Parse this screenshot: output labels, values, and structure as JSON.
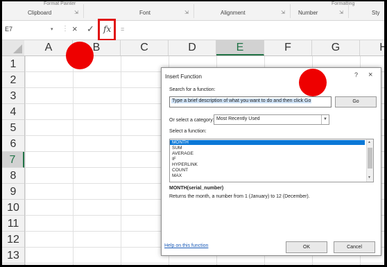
{
  "ribbon": {
    "groups": [
      "Clipboard",
      "Font",
      "Alignment",
      "Number",
      "Sty"
    ],
    "top_cut": [
      "Format Painter",
      "Formatting"
    ]
  },
  "formula_bar": {
    "name_box": "E7",
    "cancel_icon": "×",
    "enter_icon": "✓",
    "fx_label": "fx",
    "formula": "="
  },
  "columns": [
    "A",
    "B",
    "C",
    "D",
    "E",
    "F",
    "G",
    "H"
  ],
  "rows": [
    "1",
    "2",
    "3",
    "4",
    "5",
    "6",
    "7",
    "8",
    "9",
    "10",
    "11",
    "12",
    "13"
  ],
  "selected_cell": {
    "column": "E",
    "row": "7"
  },
  "dialog": {
    "title": "Insert Function",
    "help_glyph": "?",
    "close_glyph": "×",
    "search_label": "Search for a function:",
    "search_value": "Type a brief description of what you want to do and then click Go",
    "go_label": "Go",
    "category_label": "Or select a category:",
    "category_value": "Most Recently Used",
    "function_label": "Select a function:",
    "functions": [
      "MONTH",
      "SUM",
      "AVERAGE",
      "IF",
      "HYPERLINK",
      "COUNT",
      "MAX"
    ],
    "selected_function": "MONTH",
    "signature": "MONTH(serial_number)",
    "description": "Returns the month, a number from 1 (January) to 12 (December).",
    "help_link": "Help on this function",
    "ok_label": "OK",
    "cancel_label": "Cancel"
  },
  "colors": {
    "accent": "#217346",
    "highlight_red": "#ee0000",
    "selection_blue": "#0b78d7"
  }
}
